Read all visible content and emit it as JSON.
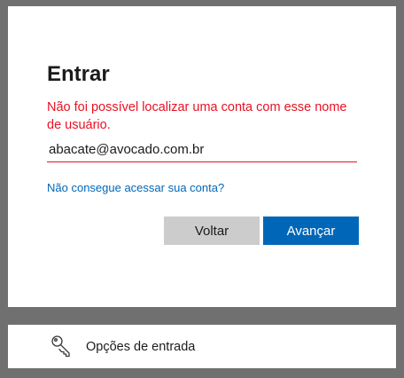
{
  "signin": {
    "title": "Entrar",
    "error_message": "Não foi possível localizar uma conta com esse nome de usuário.",
    "account_value": "abacate@avocado.com.br",
    "help_link": "Não consegue acessar sua conta?",
    "back_label": "Voltar",
    "next_label": "Avançar"
  },
  "sign_in_options": {
    "icon": "key-icon",
    "label": "Opções de entrada"
  },
  "colors": {
    "error": "#e81123",
    "accent": "#0067b8",
    "secondary_button": "#cccccc",
    "backdrop": "#707070"
  }
}
